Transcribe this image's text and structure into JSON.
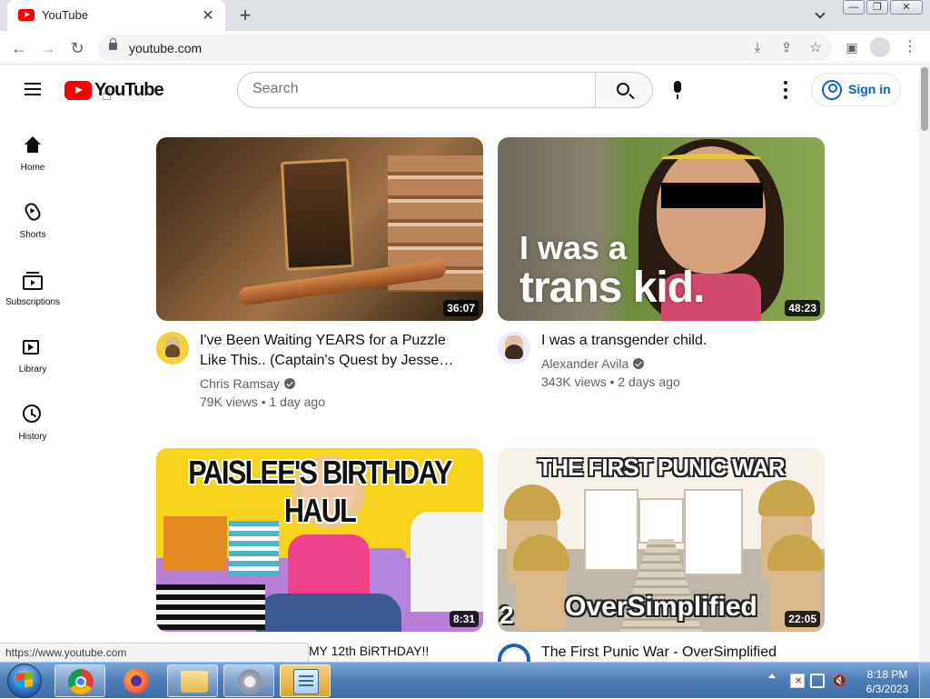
{
  "browser": {
    "tab_title": "YouTube",
    "tab_close": "✕",
    "new_tab": "+",
    "window_buttons": [
      "—",
      "❐",
      "✕"
    ],
    "nav": {
      "back": "←",
      "forward": "→",
      "reload": "↻"
    },
    "url": "youtube.com",
    "omnibox_icons": [
      "download-icon",
      "share-icon",
      "star-icon"
    ],
    "toolbar_icons": [
      "side-panel-icon",
      "profile-icon",
      "menu-icon"
    ],
    "status_url": "https://www.youtube.com"
  },
  "youtube": {
    "logo_text": "YouTube",
    "search_placeholder": "Search",
    "sign_in": "Sign in",
    "sidebar": [
      {
        "label": "Home",
        "icon": "home-icon"
      },
      {
        "label": "Shorts",
        "icon": "shorts-icon"
      },
      {
        "label": "Subscriptions",
        "icon": "subscriptions-icon"
      },
      {
        "label": "Library",
        "icon": "library-icon"
      },
      {
        "label": "History",
        "icon": "history-icon"
      }
    ],
    "videos": [
      {
        "title": "I've Been Waiting YEARS for a Puzzle Like This.. (Captain's Quest by Jesse…",
        "channel": "Chris Ramsay",
        "verified": true,
        "views": "79K views",
        "age": "1 day ago",
        "duration": "36:07"
      },
      {
        "title": "I was a transgender child.",
        "channel": "Alexander Avila",
        "verified": true,
        "views": "343K views",
        "age": "2 days ago",
        "duration": "48:23",
        "thumb_text_1": "I was a",
        "thumb_text_2": "trans kid."
      },
      {
        "title_partial": "MY 12th BiRTHDAY!!",
        "duration": "8:31",
        "thumb_banner": "PAISLEE'S BIRTHDAY HAUL"
      },
      {
        "title": "The First Punic War - OverSimplified",
        "duration": "22:05",
        "thumb_banner": "THE FIRST PUNIC WAR",
        "thumb_bottom": "OverSimplified",
        "thumb_number": "2"
      }
    ]
  },
  "taskbar": {
    "time": "8:18 PM",
    "date": "6/3/2023",
    "apps": [
      "chrome-icon",
      "firefox-icon",
      "explorer-icon",
      "speaker-icon",
      "control-panel-icon"
    ]
  }
}
